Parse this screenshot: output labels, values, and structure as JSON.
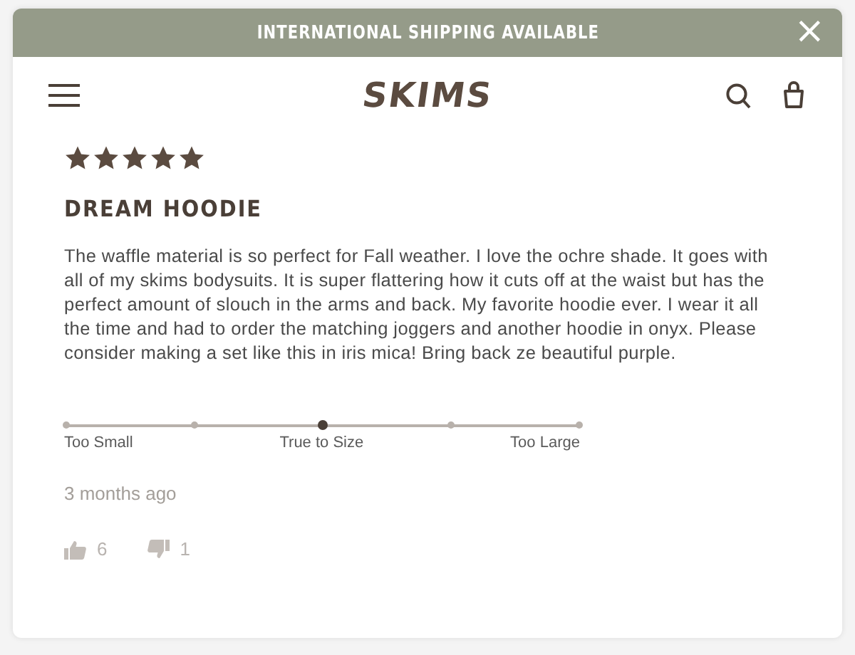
{
  "banner": {
    "text": "INTERNATIONAL SHIPPING AVAILABLE",
    "close": "×"
  },
  "header": {
    "logo": "SKIMS"
  },
  "review": {
    "stars": 5,
    "title": "DREAM HOODIE",
    "body": "The waffle material is so perfect for Fall weather. I love the ochre shade. It goes with all of my skims bodysuits. It is super flattering how it cuts off at the waist but has the perfect amount of slouch in the arms and back. My favorite hoodie ever. I wear it all the time and had to order the matching joggers and another hoodie in onyx. Please consider making a set like this in iris mica! Bring back ze beautiful purple.",
    "fit": {
      "points": [
        {
          "selected": false
        },
        {
          "selected": false
        },
        {
          "selected": true
        },
        {
          "selected": false
        },
        {
          "selected": false
        }
      ],
      "labels": [
        "Too Small",
        "True to Size",
        "Too Large"
      ]
    },
    "time": "3 months ago",
    "helpful": "6",
    "unhelpful": "1"
  }
}
